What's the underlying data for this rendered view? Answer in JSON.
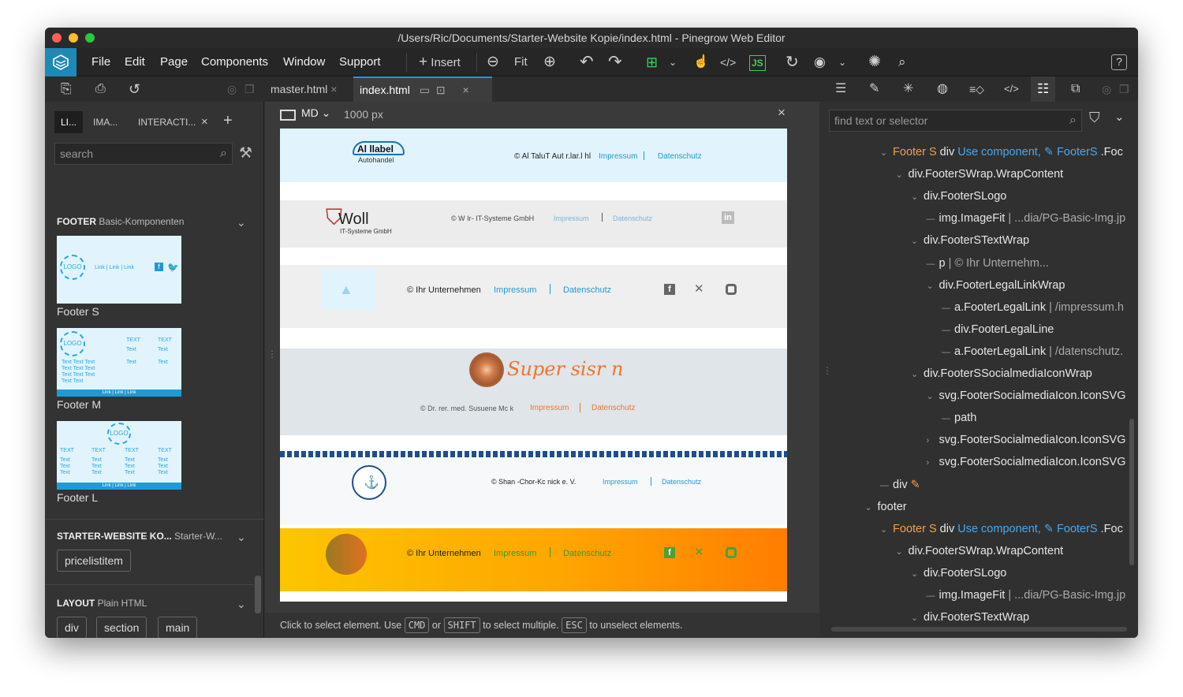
{
  "window": {
    "title": "/Users/Ric/Documents/Starter-Website Kopie/index.html - Pinegrow Web Editor"
  },
  "menu": [
    "File",
    "Edit",
    "Page",
    "Components",
    "Window",
    "Support"
  ],
  "toolbar": {
    "insert_label": "Insert",
    "fit_label": "Fit",
    "js_label": "JS"
  },
  "tabs": {
    "master": "master.html",
    "index": "index.html"
  },
  "left": {
    "tabs": [
      "LI...",
      "IMA...",
      "INTERACTI..."
    ],
    "search_placeholder": "search",
    "footer_section": {
      "title": "FOOTER",
      "subtitle": "Basic-Komponenten"
    },
    "thumbs": [
      {
        "label": "Footer S"
      },
      {
        "label": "Footer M"
      },
      {
        "label": "Footer L"
      }
    ],
    "thumb_text": {
      "logo": "LOGO",
      "links": "Link | Link | Link",
      "text": "TEXT",
      "small": "Text",
      "small3": "Text Text Text",
      "small2": "Text Text"
    },
    "starter_section": {
      "title": "STARTER-WEBSITE KO...",
      "subtitle": "Starter-W..."
    },
    "starter_items": [
      "pricelistitem"
    ],
    "layout_section": {
      "title": "LAYOUT",
      "subtitle": "Plain HTML"
    },
    "layout_items": [
      "div",
      "section",
      "main"
    ]
  },
  "canvas": {
    "device": "MD",
    "width": "1000 px",
    "footers": [
      {
        "logo": "Al llabel",
        "sub": "Autohandel",
        "text": "© Al TaluT Aut r.lar.l hl",
        "link1": "Impressum",
        "link2": "Datenschutz"
      },
      {
        "logo": "Woll",
        "sub": "IT-Systeme GmbH",
        "text": "© W  Ir-  IT-Systeme GmbH",
        "link1": "Impressum",
        "link2": "Datenschutz"
      },
      {
        "text": "© Ihr Unternehmen",
        "link1": "Impressum",
        "link2": "Datenschutz"
      },
      {
        "logo": "Super sisr n",
        "text": "© Dr. rer. med. Susuene Mc  k",
        "link1": "Impressum",
        "link2": "Datenschutz"
      },
      {
        "text": "© Shan  -Chor-Kc  nick e. V.",
        "link1": "Impressum",
        "link2": "Datenschutz"
      },
      {
        "text": "© Ihr Unternehmen",
        "link1": "Impressum",
        "link2": "Datenschutz"
      }
    ]
  },
  "status": {
    "prefix": "Click to select element. Use",
    "k1": "CMD",
    "mid1": "or",
    "k2": "SHIFT",
    "mid2": "to select multiple.",
    "k3": "ESC",
    "suffix": "to unselect elements."
  },
  "right": {
    "search_placeholder": "find text or selector",
    "tree": [
      {
        "indent": 0,
        "arrow": "v",
        "parts": [
          [
            "o",
            "Footer S"
          ],
          [
            "w",
            " div  "
          ],
          [
            "b",
            "Use component,  ✎ FooterS"
          ],
          [
            "w",
            " .Foc"
          ]
        ]
      },
      {
        "indent": 1,
        "arrow": "v",
        "parts": [
          [
            "w",
            "div.FooterSWrap.WrapContent"
          ]
        ]
      },
      {
        "indent": 2,
        "arrow": "v",
        "parts": [
          [
            "w",
            "div.FooterSLogo"
          ]
        ]
      },
      {
        "indent": 3,
        "arrow": "-",
        "parts": [
          [
            "w",
            "img.ImageFit"
          ],
          [
            "g",
            " | ...dia/PG-Basic-Img.jp"
          ]
        ]
      },
      {
        "indent": 2,
        "arrow": "v",
        "parts": [
          [
            "w",
            "div.FooterSTextWrap"
          ]
        ]
      },
      {
        "indent": 3,
        "arrow": "-",
        "parts": [
          [
            "w",
            "p"
          ],
          [
            "g",
            " | © Ihr Unternehm..."
          ]
        ]
      },
      {
        "indent": 3,
        "arrow": "v",
        "parts": [
          [
            "w",
            "div.FooterLegalLinkWrap"
          ]
        ]
      },
      {
        "indent": 4,
        "arrow": "-",
        "parts": [
          [
            "w",
            "a.FooterLegalLink"
          ],
          [
            "g",
            " | /impressum.h"
          ]
        ]
      },
      {
        "indent": 4,
        "arrow": "-",
        "parts": [
          [
            "w",
            "div.FooterLegalLine"
          ]
        ]
      },
      {
        "indent": 4,
        "arrow": "-",
        "parts": [
          [
            "w",
            "a.FooterLegalLink"
          ],
          [
            "g",
            " | /datenschutz."
          ]
        ]
      },
      {
        "indent": 2,
        "arrow": "v",
        "parts": [
          [
            "w",
            "div.FooterSSocialmediaIconWrap"
          ]
        ]
      },
      {
        "indent": 3,
        "arrow": "v",
        "parts": [
          [
            "w",
            "svg.FooterSocialmediaIcon.IconSVG"
          ]
        ]
      },
      {
        "indent": 4,
        "arrow": "-",
        "parts": [
          [
            "w",
            "path"
          ]
        ]
      },
      {
        "indent": 3,
        "arrow": ">",
        "parts": [
          [
            "w",
            "svg.FooterSocialmediaIcon.IconSVG"
          ]
        ]
      },
      {
        "indent": 3,
        "arrow": ">",
        "parts": [
          [
            "w",
            "svg.FooterSocialmediaIcon.IconSVG"
          ]
        ]
      },
      {
        "indent": 0,
        "arrow": "-",
        "parts": [
          [
            "w",
            "div "
          ],
          [
            "o",
            "✎"
          ]
        ]
      },
      {
        "indent": -1,
        "arrow": "v",
        "parts": [
          [
            "w",
            "footer"
          ]
        ]
      },
      {
        "indent": 0,
        "arrow": "v",
        "parts": [
          [
            "o",
            "Footer S"
          ],
          [
            "w",
            " div  "
          ],
          [
            "b",
            "Use component,  ✎ FooterS"
          ],
          [
            "w",
            " .Foc"
          ]
        ]
      },
      {
        "indent": 1,
        "arrow": "v",
        "parts": [
          [
            "w",
            "div.FooterSWrap.WrapContent"
          ]
        ]
      },
      {
        "indent": 2,
        "arrow": "v",
        "parts": [
          [
            "w",
            "div.FooterSLogo"
          ]
        ]
      },
      {
        "indent": 3,
        "arrow": "-",
        "parts": [
          [
            "w",
            "img.ImageFit"
          ],
          [
            "g",
            " | ...dia/PG-Basic-Img.jp"
          ]
        ]
      },
      {
        "indent": 2,
        "arrow": "v",
        "parts": [
          [
            "w",
            "div.FooterSTextWrap"
          ]
        ]
      }
    ]
  }
}
